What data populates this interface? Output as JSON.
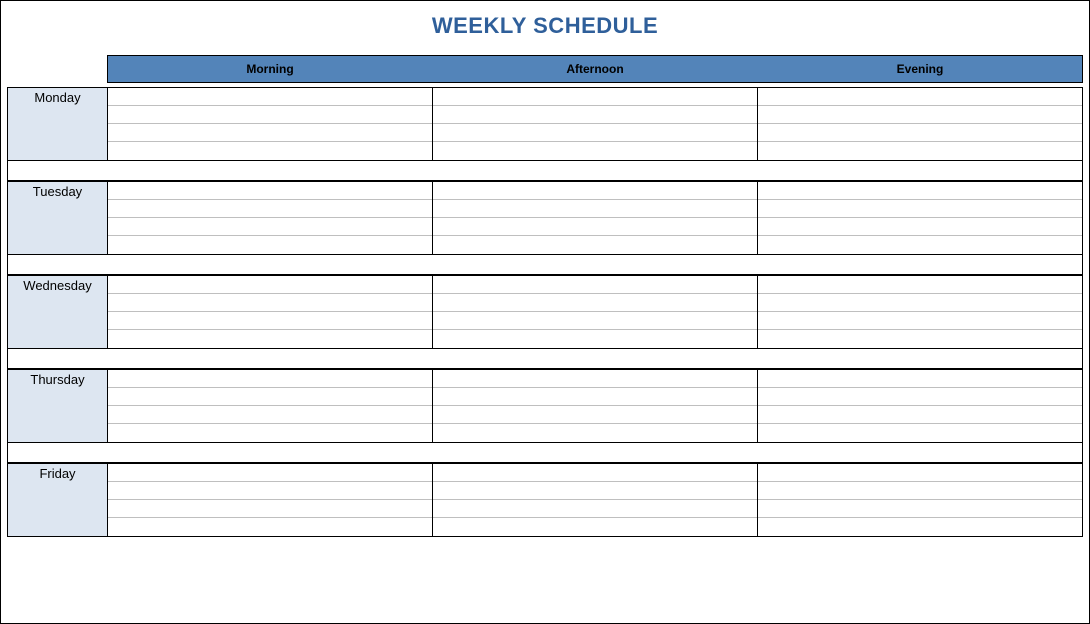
{
  "title": "WEEKLY SCHEDULE",
  "columns": [
    "Morning",
    "Afternoon",
    "Evening"
  ],
  "days": [
    "Monday",
    "Tuesday",
    "Wednesday",
    "Thursday",
    "Friday"
  ],
  "rows_per_cell": 4,
  "colors": {
    "title": "#2f5f9a",
    "header_bg": "#5384b9",
    "day_bg": "#dde6f1"
  },
  "cells": {
    "Monday": {
      "Morning": [
        "",
        "",
        "",
        ""
      ],
      "Afternoon": [
        "",
        "",
        "",
        ""
      ],
      "Evening": [
        "",
        "",
        "",
        ""
      ]
    },
    "Tuesday": {
      "Morning": [
        "",
        "",
        "",
        ""
      ],
      "Afternoon": [
        "",
        "",
        "",
        ""
      ],
      "Evening": [
        "",
        "",
        "",
        ""
      ]
    },
    "Wednesday": {
      "Morning": [
        "",
        "",
        "",
        ""
      ],
      "Afternoon": [
        "",
        "",
        "",
        ""
      ],
      "Evening": [
        "",
        "",
        "",
        ""
      ]
    },
    "Thursday": {
      "Morning": [
        "",
        "",
        "",
        ""
      ],
      "Afternoon": [
        "",
        "",
        "",
        ""
      ],
      "Evening": [
        "",
        "",
        "",
        ""
      ]
    },
    "Friday": {
      "Morning": [
        "",
        "",
        "",
        ""
      ],
      "Afternoon": [
        "",
        "",
        "",
        ""
      ],
      "Evening": [
        "",
        "",
        "",
        ""
      ]
    }
  }
}
